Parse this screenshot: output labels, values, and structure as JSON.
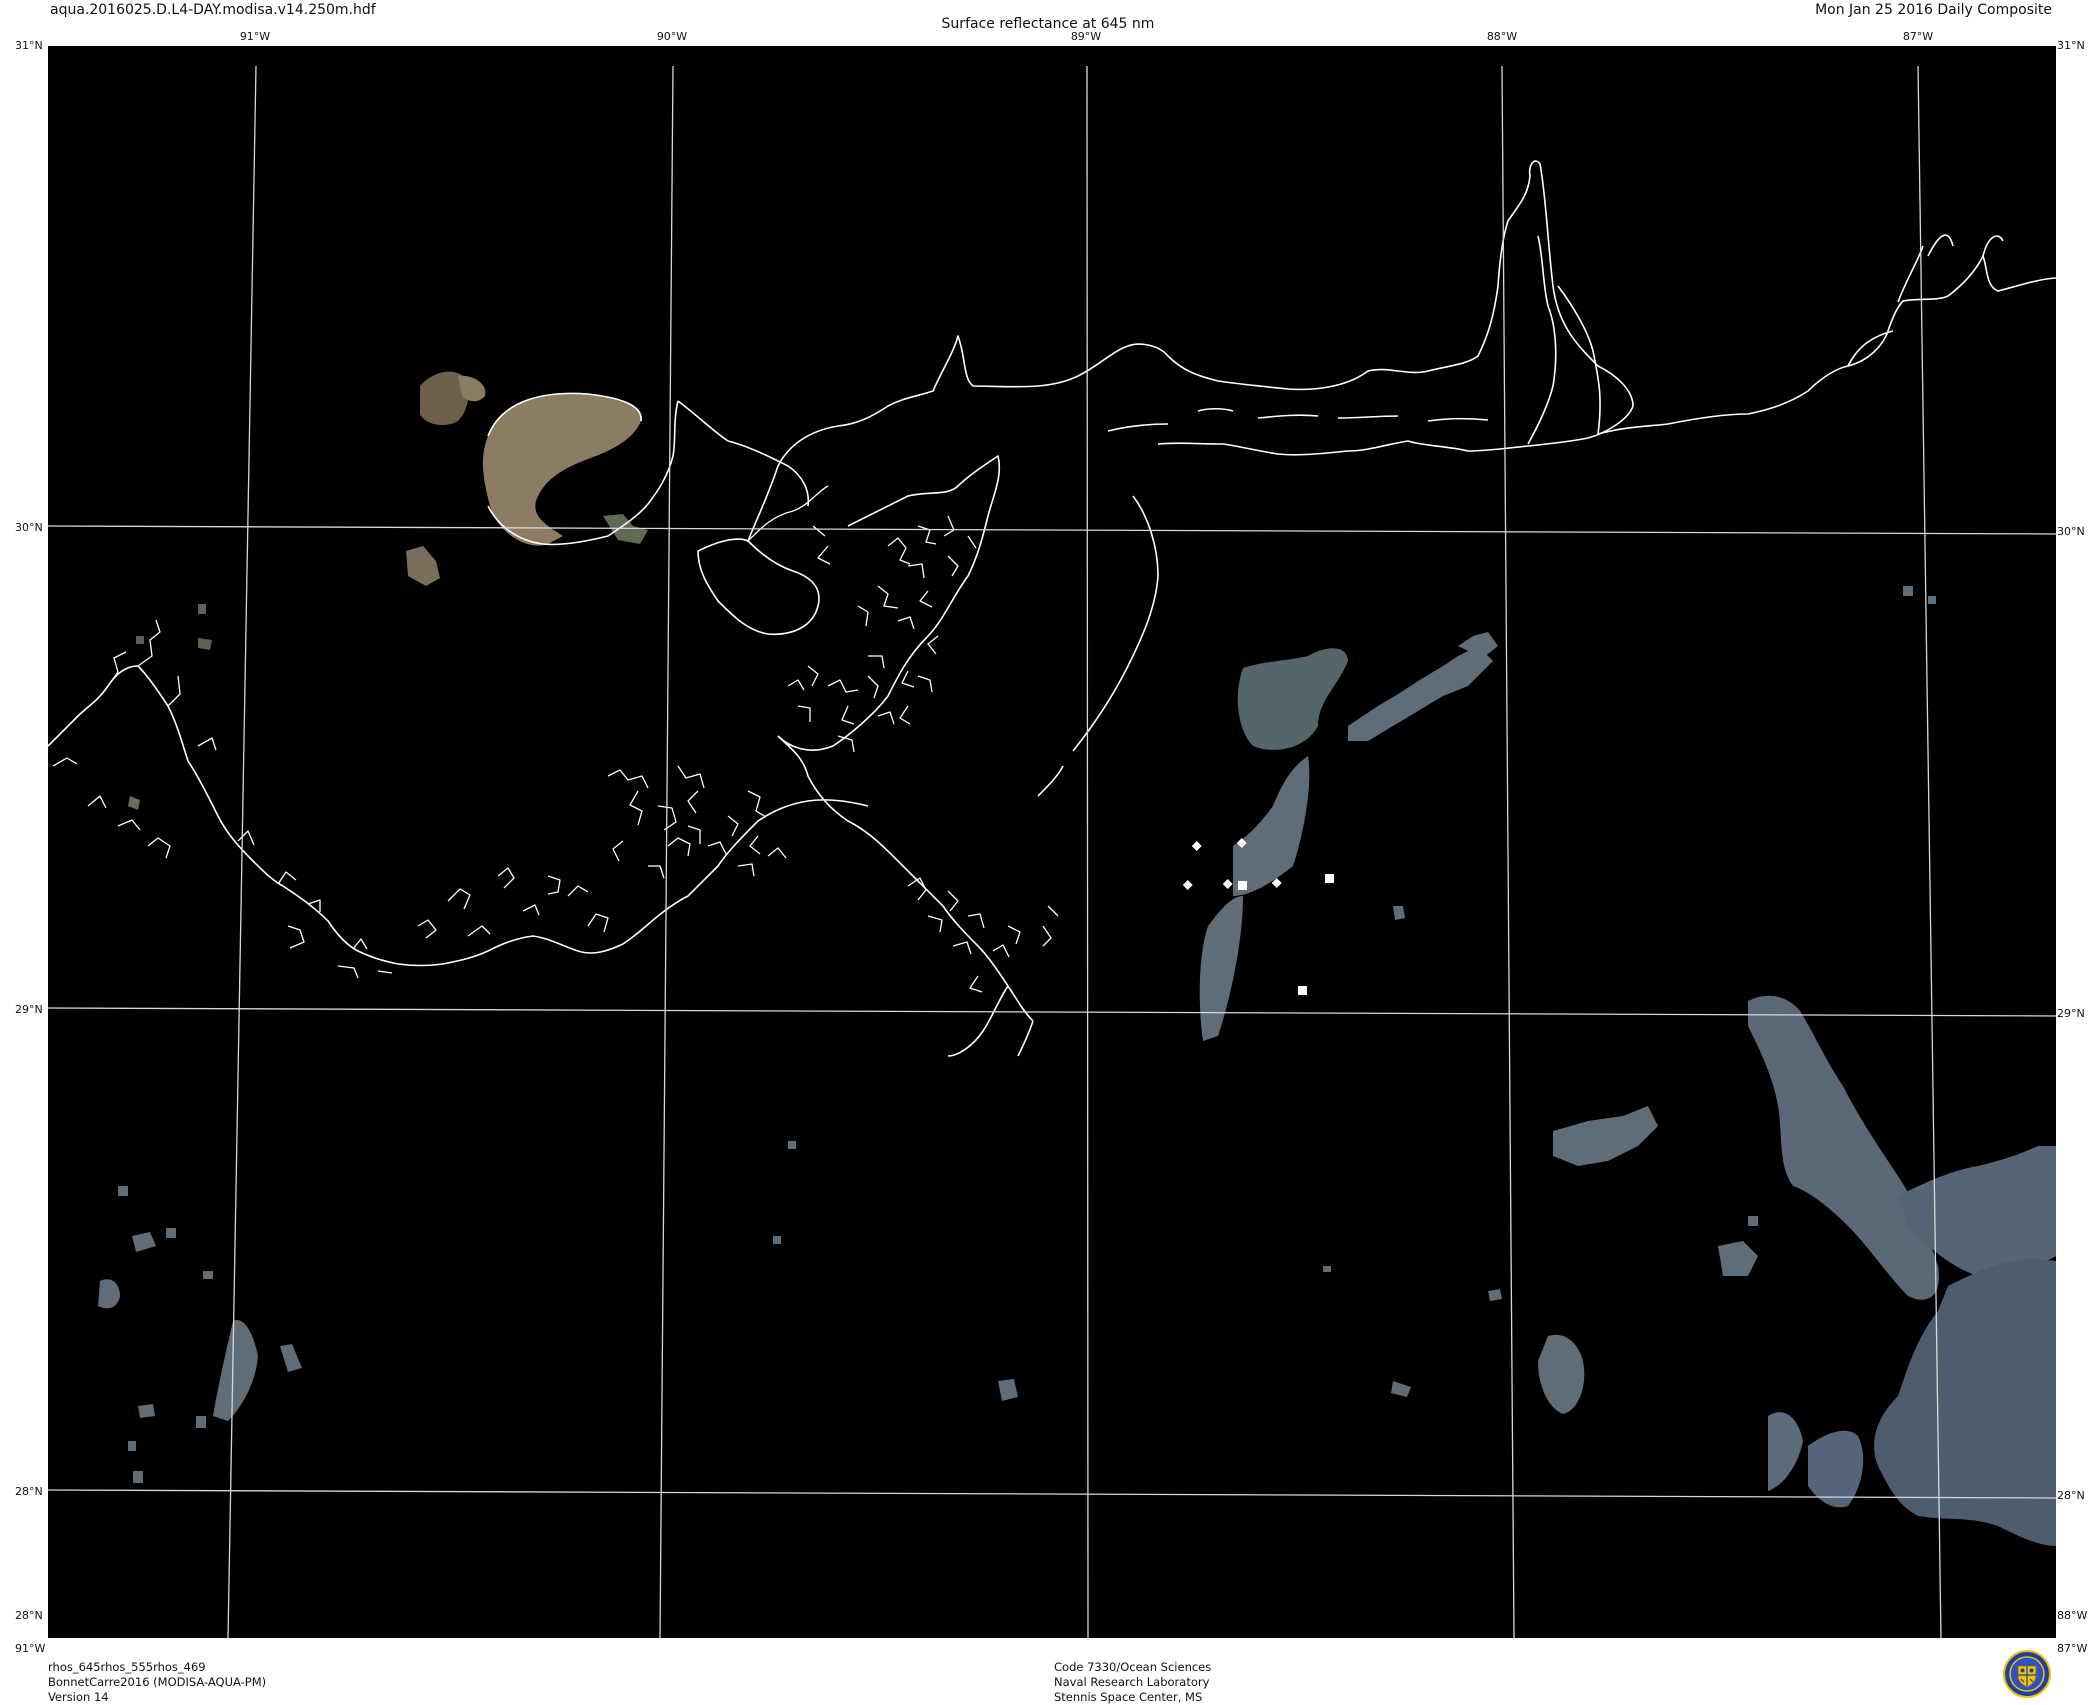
{
  "header": {
    "file_name": "aqua.2016025.D.L4-DAY.modisa.v14.250m.hdf",
    "title": "Surface reflectance at 645 nm",
    "date": "Mon Jan 25 2016 Daily Composite"
  },
  "graticule": {
    "longitude_labels": [
      "91°W",
      "90°W",
      "89°W",
      "88°W",
      "87°W"
    ],
    "latitude_labels": [
      "30°N",
      "29°N",
      "28°N"
    ],
    "corner_labels": {
      "top_left": "31°N",
      "top_right": "31°N",
      "bottom_left": "91°W",
      "bottom_right": "87°W",
      "bottom_left_lat": "28°N",
      "bottom_right_lat": "88°W"
    }
  },
  "footer": {
    "left": [
      "rhos_645rhos_555rhos_469",
      "BonnetCarre2016 (MODISA-AQUA-PM)",
      "Version 14"
    ],
    "center": [
      "Code 7330/Ocean Sciences",
      "Naval Research Laboratory",
      "Stennis Space Center, MS"
    ]
  },
  "colors": {
    "background": "#000000",
    "graticule": "#d8d8d8",
    "coastline": "#ffffff",
    "turbid_water": "#8a7a62",
    "cloud_sediment": "#5e6c78"
  },
  "logo": {
    "icon": "nrl-seal-icon"
  }
}
